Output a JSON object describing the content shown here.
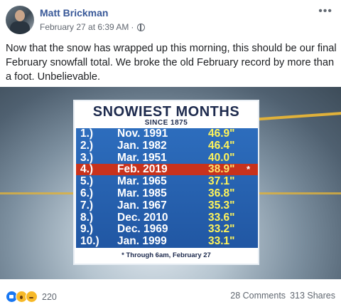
{
  "post": {
    "author": "Matt Brickman",
    "timestamp": "February 27 at 6:39 AM",
    "separator": "·",
    "privacy_icon": "globe-icon",
    "more_label": "•••",
    "text": "Now that the snow has wrapped up this morning, this should be our final February snowfall total. We broke the old February record by more than a foot. Unbelievable."
  },
  "graphic": {
    "title": "SNOWIEST MONTHS",
    "subtitle": "SINCE 1875",
    "rows": [
      {
        "rank": "1.)",
        "month": "Nov. 1991",
        "amount": "46.9\"",
        "star": ""
      },
      {
        "rank": "2.)",
        "month": "Jan. 1982",
        "amount": "46.4\"",
        "star": ""
      },
      {
        "rank": "3.)",
        "month": "Mar. 1951",
        "amount": "40.0\"",
        "star": ""
      },
      {
        "rank": "4.)",
        "month": "Feb. 2019",
        "amount": "38.9\"",
        "star": "*"
      },
      {
        "rank": "5.)",
        "month": "Mar. 1965",
        "amount": "37.1\"",
        "star": ""
      },
      {
        "rank": "6.)",
        "month": "Mar. 1985",
        "amount": "36.8\"",
        "star": ""
      },
      {
        "rank": "7.)",
        "month": "Jan. 1967",
        "amount": "35.3\"",
        "star": ""
      },
      {
        "rank": "8.)",
        "month": "Dec. 2010",
        "amount": "33.6\"",
        "star": ""
      },
      {
        "rank": "9.)",
        "month": "Dec. 1969",
        "amount": "33.2\"",
        "star": ""
      },
      {
        "rank": "10.)",
        "month": "Jan. 1999",
        "amount": "33.1\"",
        "star": ""
      }
    ],
    "footnote": "* Through 6am, February 27",
    "highlight_color": "#c8321c",
    "table_color": "#2a63b3",
    "amount_color": "#fff45a"
  },
  "footer": {
    "reaction_icons": [
      "like-icon",
      "wow-icon",
      "sad-icon"
    ],
    "reaction_count": "220",
    "comments": "28 Comments",
    "shares": "313 Shares"
  }
}
